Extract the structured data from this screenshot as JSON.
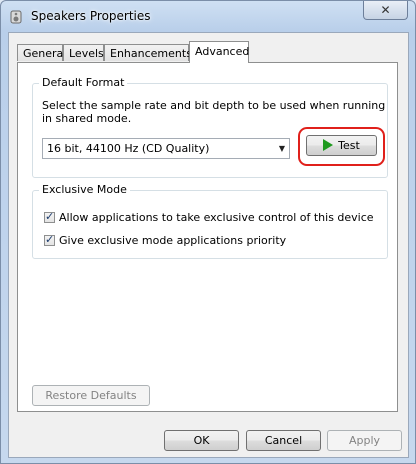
{
  "window": {
    "title": "Speakers Properties",
    "close_label": "✕"
  },
  "tabs": [
    {
      "label": "General"
    },
    {
      "label": "Levels"
    },
    {
      "label": "Enhancements"
    },
    {
      "label": "Advanced"
    }
  ],
  "default_format": {
    "title": "Default Format",
    "description": "Select the sample rate and bit depth to be used when running in shared mode.",
    "selected_format": "16 bit, 44100 Hz (CD Quality)",
    "test_label": "Test"
  },
  "exclusive_mode": {
    "title": "Exclusive Mode",
    "options": [
      {
        "label": "Allow applications to take exclusive control of this device",
        "checked": true
      },
      {
        "label": "Give exclusive mode applications priority",
        "checked": true
      }
    ]
  },
  "buttons": {
    "restore_defaults": "Restore Defaults",
    "ok": "OK",
    "cancel": "Cancel",
    "apply": "Apply"
  },
  "colors": {
    "highlight": "#e0201b",
    "play_icon": "#1f9a1f"
  }
}
